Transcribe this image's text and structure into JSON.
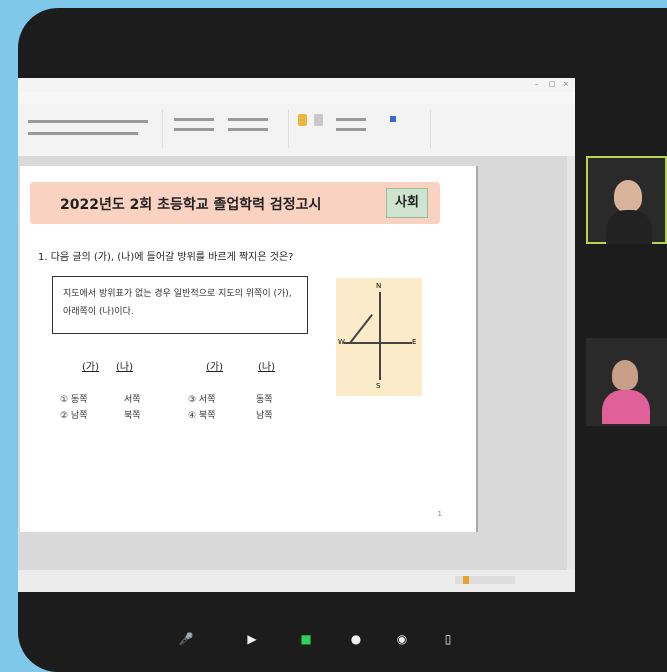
{
  "document": {
    "header_title": "2022년도 2회 초등학교 졸업학력 검정고시",
    "subject": "사회",
    "question": {
      "number": "1.",
      "text_before": "다음 글의 (가), (나)에 들어갈 방위를 바르게 짝지은 것은?",
      "highlight": "",
      "text_after": ""
    },
    "passage": "지도에서 방위표가 없는 경우 일반적으로 지도의 위쪽이 (가), 아래쪽이 (나)이다.",
    "compass": {
      "n": "N",
      "s": "S",
      "w": "W",
      "e": "E",
      "color": "#fcebc8"
    },
    "option_headers": [
      "(가)",
      "(나)",
      "(가)",
      "(나)"
    ],
    "options": [
      {
        "a": "① 동쪽",
        "b": "서쪽"
      },
      {
        "a": "② 남쪽",
        "b": "북쪽"
      },
      {
        "a": "③ 서쪽",
        "b": "동쪽"
      },
      {
        "a": "④ 북쪽",
        "b": "남쪽"
      }
    ],
    "page_number": "1"
  },
  "participants": [
    {
      "name": "",
      "active": true,
      "shirt": "#2a2a2a"
    },
    {
      "name": "",
      "active": false,
      "shirt": "#e0609a"
    }
  ],
  "toolbar": {
    "items": [
      {
        "icon": "🎤",
        "label": "",
        "name": "mute-icon"
      },
      {
        "icon": "▶",
        "label": "",
        "name": "video-icon"
      },
      {
        "icon": "■",
        "label": "",
        "name": "share-screen-icon",
        "green": true
      },
      {
        "icon": "●",
        "label": "",
        "name": "participants-icon"
      },
      {
        "icon": "◉",
        "label": "",
        "name": "record-icon"
      },
      {
        "icon": "▯",
        "label": "",
        "name": "reactions-icon"
      }
    ]
  },
  "colors": {
    "background": "#7fc8ea",
    "banner": "#f9d2c2",
    "subject_box": "#cfe4cf",
    "active_border": "#b7d44c"
  }
}
